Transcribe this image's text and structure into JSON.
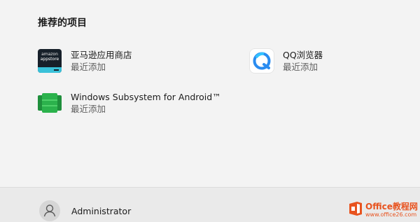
{
  "recommended": {
    "title": "推荐的项目",
    "items": [
      {
        "name": "亚马逊应用商店",
        "sub": "最近添加",
        "icon": "amazon-appstore-icon",
        "icon_text_1": "amazon",
        "icon_text_2": "appstore"
      },
      {
        "name": "QQ浏览器",
        "sub": "最近添加",
        "icon": "qq-browser-icon"
      },
      {
        "name": "Windows Subsystem for Android™",
        "sub": "最近添加",
        "icon": "wsa-icon"
      }
    ]
  },
  "user": {
    "name": "Administrator",
    "icon": "user-avatar-icon"
  },
  "watermark": {
    "brand": "Office教程网",
    "url": "www.office26.com"
  },
  "colors": {
    "background": "#f3f3f3",
    "bottom_bar": "#eaeaea",
    "amazon_accent": "#39c1d9",
    "qq_blue": "#2a8cf0",
    "wsa_green": "#2bb24c",
    "watermark_orange": "#e8531f"
  }
}
